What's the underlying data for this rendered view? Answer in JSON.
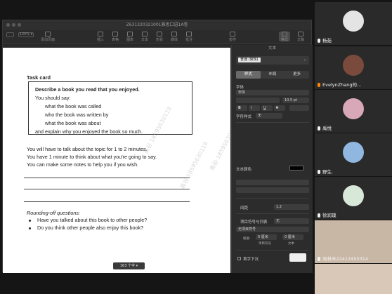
{
  "pages_window": {
    "title": "Z631320321001雅思口语1A卷",
    "toolbar": {
      "zoom": "125% ▾",
      "items": [
        "显示",
        "缩放",
        "添加页面",
        "插入",
        "表格",
        "图表",
        "文本",
        "形状",
        "媒体",
        "批注",
        "协作",
        "格式",
        "文稿"
      ]
    },
    "word_count": "163 个字 ▾"
  },
  "document": {
    "task_card_label": "Task card",
    "card_lines": [
      "Describe a book you read that you enjoyed.",
      "You should say:",
      "what the book was called",
      "who the book was written by",
      "what the book was about",
      "and explain why you enjoyed the book so much."
    ],
    "instructions": [
      "You will have to talk about the topic for 1 to 2 minutes.",
      "You have 1 minute to think about what you're going to say.",
      "You can make some notes to help you if you wish."
    ],
    "rounding_off_title": "Rounding-off questions:",
    "rounding_off_questions": [
      "Have you talked about this book to other people?",
      "Do you think other people also enjoy this book?"
    ],
    "watermarks": [
      "高谷 18595630119",
      "高谷 18595630119",
      "高谷 18595630119"
    ]
  },
  "format_panel": {
    "header": "文本",
    "paragraph_style": "普通 (常规)",
    "tabs": [
      "样式",
      "布局",
      "更多"
    ],
    "font_label": "字体",
    "font_name": "宋体",
    "font_size": "10.5 pt",
    "bold": "B",
    "italic": "I",
    "underline": "U",
    "strike": "S",
    "char_style_label": "字符样式",
    "char_style": "无",
    "text_color_label": "文本颜色",
    "spacing_label": "间距",
    "spacing_value": "1.2",
    "list_label": "项目符号与列表",
    "list_value": "无",
    "bullet_label": "无项目符号",
    "indent_value": "0 厘米",
    "indent_labels": [
      "缩进:",
      "项目符号",
      "文本"
    ],
    "dropcap_label": "首字下沉"
  },
  "participants": [
    {
      "name": "杨茹",
      "avatar_color": "#e4e4e4"
    },
    {
      "name": "EvelynZhang的...",
      "avatar_color": "#7a4a3c"
    },
    {
      "name": "禹悦",
      "avatar_color": "#d8a8b8"
    },
    {
      "name": "野生.",
      "avatar_color": "#8fb7e0"
    },
    {
      "name": "徐润璞",
      "avatar_color": "#d7e7d8"
    },
    {
      "name": "周林禾22413450314",
      "avatar_color": "#c9b7a6"
    },
    {
      "name": "",
      "avatar_color": "#d9c7b8"
    }
  ]
}
